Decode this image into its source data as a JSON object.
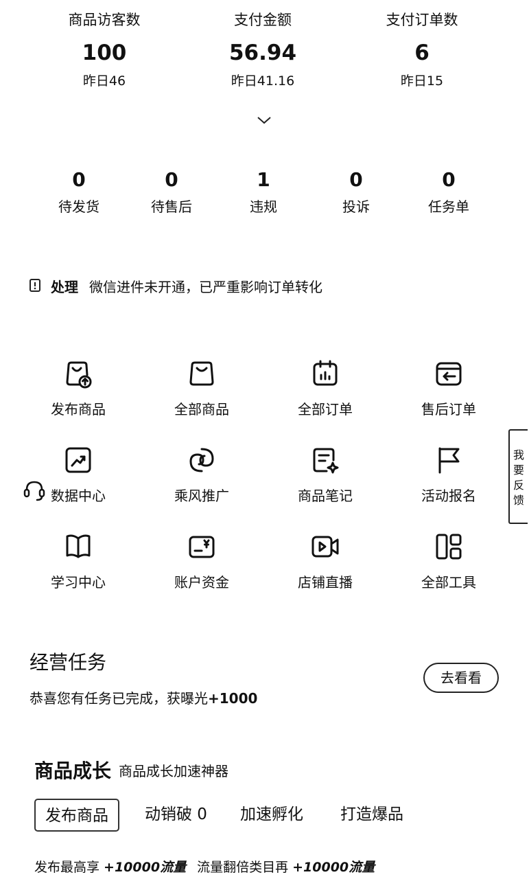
{
  "stats": [
    {
      "label": "商品访客数",
      "value": "100",
      "yesterday": "昨日46"
    },
    {
      "label": "支付金额",
      "value": "56.94",
      "yesterday": "昨日41.16"
    },
    {
      "label": "支付订单数",
      "value": "6",
      "yesterday": "昨日15"
    }
  ],
  "counters": [
    {
      "count": "0",
      "label": "待发货"
    },
    {
      "count": "0",
      "label": "待售后"
    },
    {
      "count": "1",
      "label": "违规"
    },
    {
      "count": "0",
      "label": "投诉"
    },
    {
      "count": "0",
      "label": "任务单"
    }
  ],
  "notice": {
    "action": "处理",
    "message": "微信进件未开通，已严重影响订单转化",
    "icon": "alert-icon"
  },
  "tools": [
    {
      "label": "发布商品",
      "icon": "bag-upload-icon"
    },
    {
      "label": "全部商品",
      "icon": "bag-icon"
    },
    {
      "label": "全部订单",
      "icon": "order-list-icon"
    },
    {
      "label": "售后订单",
      "icon": "return-box-icon"
    },
    {
      "label": "数据中心",
      "icon": "trend-chart-icon"
    },
    {
      "label": "乘风推广",
      "icon": "swirl-icon"
    },
    {
      "label": "商品笔记",
      "icon": "note-sparkle-icon"
    },
    {
      "label": "活动报名",
      "icon": "flag-icon"
    },
    {
      "label": "学习中心",
      "icon": "book-icon"
    },
    {
      "label": "账户资金",
      "icon": "wallet-yen-icon"
    },
    {
      "label": "店铺直播",
      "icon": "video-camera-icon"
    },
    {
      "label": "全部工具",
      "icon": "grid-tools-icon"
    }
  ],
  "feedback": {
    "chars": [
      "我",
      "要",
      "反",
      "馈"
    ]
  },
  "tasks": {
    "title": "经营任务",
    "desc_prefix": "恭喜您有任务已完成，获曝光",
    "desc_bonus": "+1000",
    "button": "去看看"
  },
  "growth": {
    "title": "商品成长",
    "subtitle": "商品成长加速神器",
    "tabs": [
      "发布商品",
      "动销破 0",
      "加速孵化",
      "打造爆品"
    ],
    "active_tab": "发布商品",
    "info_1": "发布最高享 ",
    "info_1_bonus": "+10000流量",
    "info_2": "流量翻倍类目再 ",
    "info_2_bonus": "+10000流量"
  }
}
